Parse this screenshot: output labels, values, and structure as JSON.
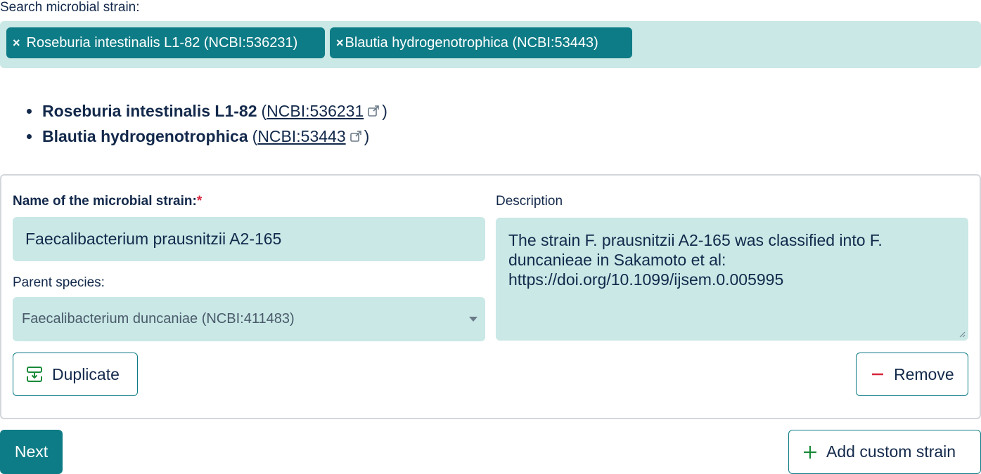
{
  "search": {
    "label": "Search microbial strain:",
    "tags": [
      {
        "label": "Roseburia intestinalis L1-82 (NCBI:536231)",
        "remove": "×"
      },
      {
        "label": "Blautia hydrogenotrophica (NCBI:53443)",
        "remove": "×"
      }
    ]
  },
  "selected_list": [
    {
      "name": "Roseburia intestinalis L1-82",
      "ncbi": "NCBI:536231"
    },
    {
      "name": "Blautia hydrogenotrophica",
      "ncbi": "NCBI:53443"
    }
  ],
  "punct": {
    "open": "(",
    "close": ")"
  },
  "custom_strain": {
    "name_label": "Name of the microbial strain:",
    "required_mark": "*",
    "name_value": "Faecalibacterium prausnitzii A2-165",
    "parent_label": "Parent species:",
    "parent_value": "Faecalibacterium duncaniae (NCBI:411483)",
    "description_label": "Description",
    "description_value": "The strain F. prausnitzii A2-165 was classified into F. duncanieae in Sakamoto et al: https://doi.org/10.1099/ijsem.0.005995",
    "duplicate_label": "Duplicate",
    "remove_label": "Remove"
  },
  "footer": {
    "next_label": "Next",
    "add_custom_label": "Add custom strain"
  },
  "colors": {
    "accent": "#0e7c86",
    "field_bg": "#c9e8e6",
    "text": "#13294b",
    "remove_icon": "#d7263d",
    "add_icon": "#1a8a3a"
  }
}
